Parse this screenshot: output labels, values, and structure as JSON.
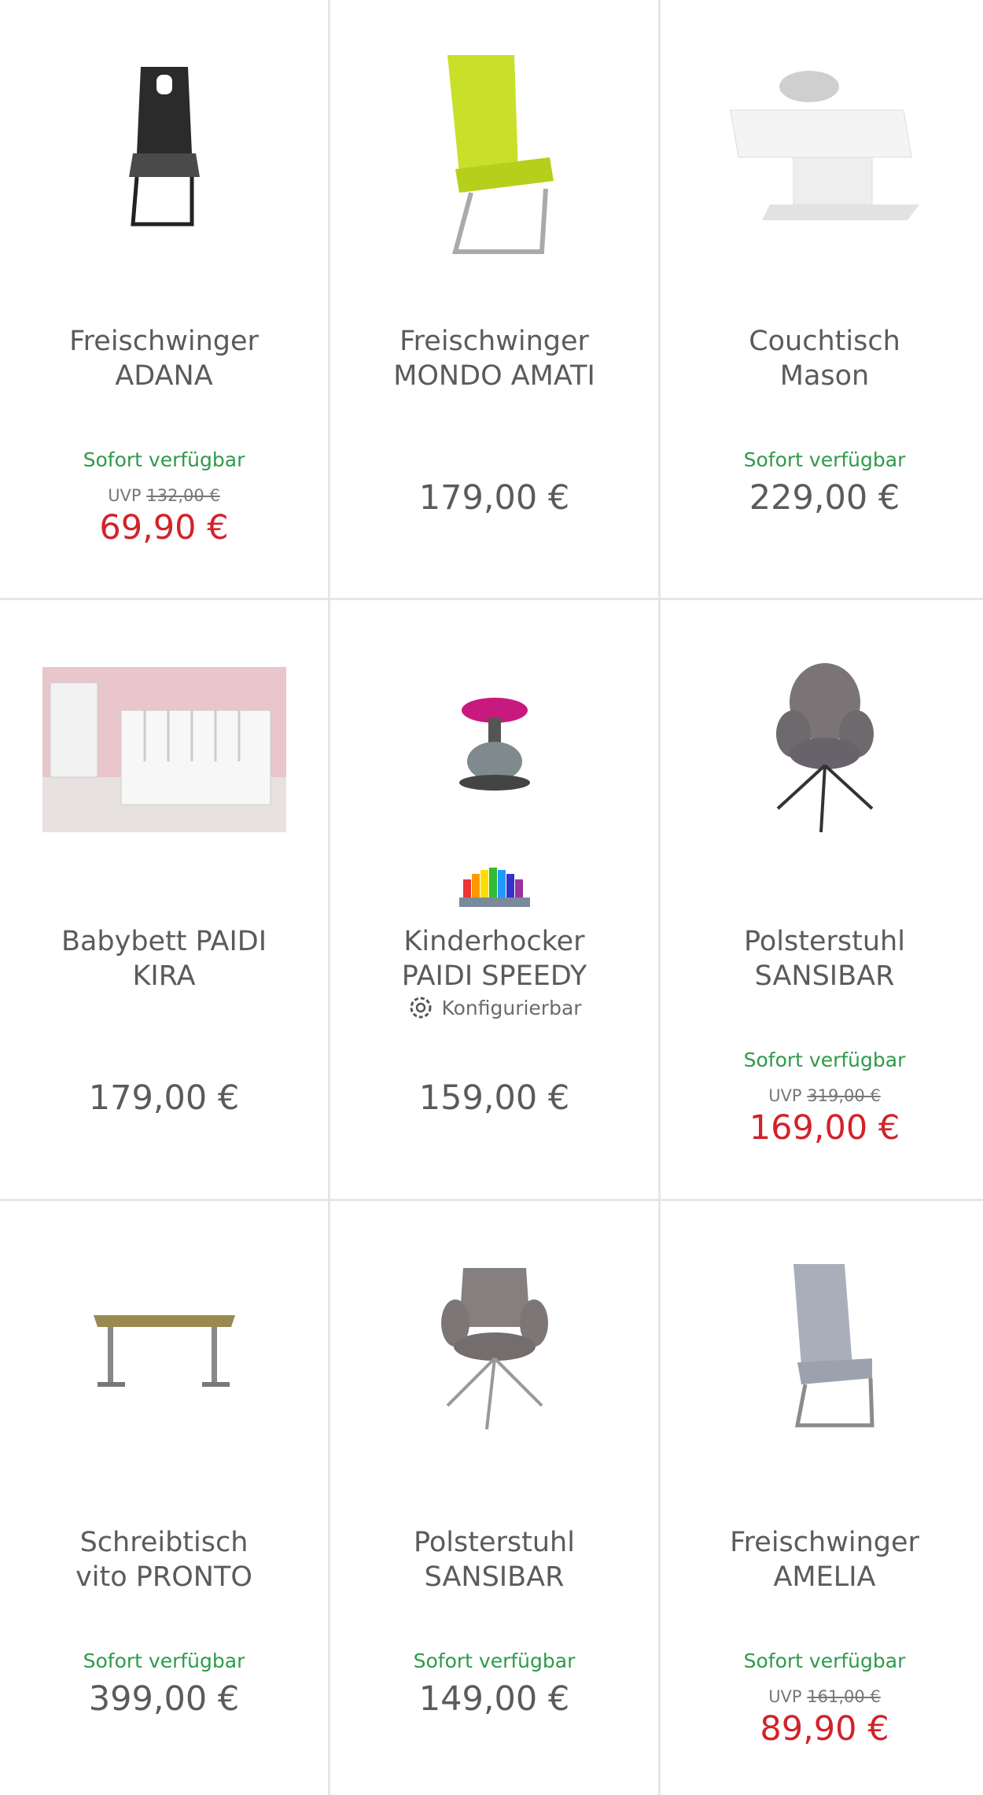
{
  "products": [
    {
      "line1": "Freischwinger",
      "line2": "ADANA",
      "availability": "Sofort verfügbar",
      "uvp_label": "UVP",
      "uvp_price": "132,00 €",
      "price": "69,90 €",
      "sale": true,
      "image": "black-cantilever-chair"
    },
    {
      "line1": "Freischwinger",
      "line2": "MONDO AMATI",
      "availability": "",
      "uvp_label": "",
      "uvp_price": "",
      "price": "179,00 €",
      "sale": false,
      "image": "lime-cantilever-chair"
    },
    {
      "line1": "Couchtisch",
      "line2": "Mason",
      "availability": "Sofort verfügbar",
      "uvp_label": "",
      "uvp_price": "",
      "price": "229,00 €",
      "sale": false,
      "image": "white-coffee-table"
    },
    {
      "line1": "Babybett PAIDI",
      "line2": "KIRA",
      "availability": "",
      "uvp_label": "",
      "uvp_price": "",
      "price": "179,00 €",
      "sale": false,
      "image": "baby-crib-room"
    },
    {
      "line1": "Kinderhocker",
      "line2": "PAIDI SPEEDY",
      "configurable": "Konfigurierbar",
      "availability": "",
      "uvp_label": "",
      "uvp_price": "",
      "price": "159,00 €",
      "sale": false,
      "image": "kids-stool"
    },
    {
      "line1": "Polsterstuhl",
      "line2": "SANSIBAR",
      "availability": "Sofort verfügbar",
      "uvp_label": "UVP",
      "uvp_price": "319,00 €",
      "price": "169,00 €",
      "sale": true,
      "image": "grey-armchair"
    },
    {
      "line1": "Schreibtisch",
      "line2": "vito PRONTO",
      "availability": "Sofort verfügbar",
      "uvp_label": "",
      "uvp_price": "",
      "price": "399,00 €",
      "sale": false,
      "image": "standing-desk"
    },
    {
      "line1": "Polsterstuhl",
      "line2": "SANSIBAR",
      "availability": "Sofort verfügbar",
      "uvp_label": "",
      "uvp_price": "",
      "price": "149,00 €",
      "sale": false,
      "image": "grey-armchair-2"
    },
    {
      "line1": "Freischwinger",
      "line2": "AMELIA",
      "availability": "Sofort verfügbar",
      "uvp_label": "UVP",
      "uvp_price": "161,00 €",
      "price": "89,90 €",
      "sale": true,
      "image": "light-grey-cantilever-chair"
    }
  ],
  "colors": {
    "available": "#2e9a4a",
    "sale": "#d2232a",
    "text": "#5b5b5b",
    "divider": "#e6e6e6"
  }
}
